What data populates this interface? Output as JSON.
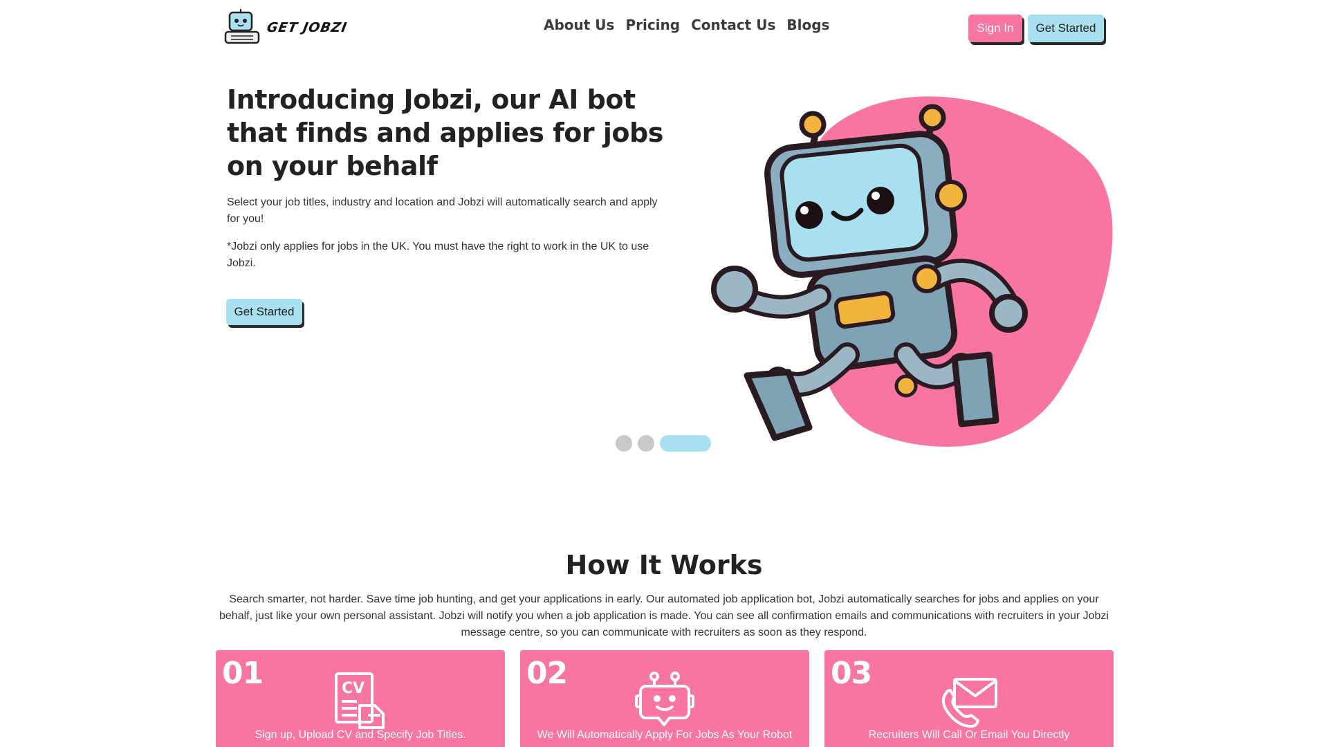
{
  "brand": {
    "name": "GET JOBZI"
  },
  "nav": {
    "links": [
      "About Us",
      "Pricing",
      "Contact Us",
      "Blogs"
    ],
    "sign_in": "Sign In",
    "get_started": "Get Started"
  },
  "hero": {
    "title": "Introducing Jobzi, our AI bot that finds and applies for jobs on your behalf",
    "subtitle": "Select your job titles, industry and location and Jobzi will automatically search and apply for you!",
    "note": "*Jobzi only applies for jobs in the UK. You must have the right to work in the UK to use Jobzi.",
    "cta": "Get Started",
    "carousel": {
      "slides": 3,
      "active_index": 2
    }
  },
  "how": {
    "title": "How It Works",
    "description": "Search smarter, not harder. Save time job hunting, and get your applications in early. Our automated job application bot, Jobzi automatically searches for jobs and applies on your behalf, just like your own personal assistant. Jobzi will notify you when a job application is made. You can see all confirmation emails and communications with recruiters in your Jobzi message centre, so you can communicate with recruiters as soon as they respond.",
    "steps": [
      {
        "number": "01",
        "text": "Sign up, Upload CV and Specify Job Titles.",
        "icon": "cv-document-icon"
      },
      {
        "number": "02",
        "text": "We Will Automatically Apply For Jobs As Your Robot",
        "icon": "robot-face-icon"
      },
      {
        "number": "03",
        "text": "Recruiters Will Call Or Email You Directly",
        "icon": "phone-email-icon"
      }
    ]
  },
  "colors": {
    "pink": "#f774a3",
    "light_blue": "#a9e0ef",
    "text": "#222222",
    "dot_inactive": "#c9c9c9"
  }
}
